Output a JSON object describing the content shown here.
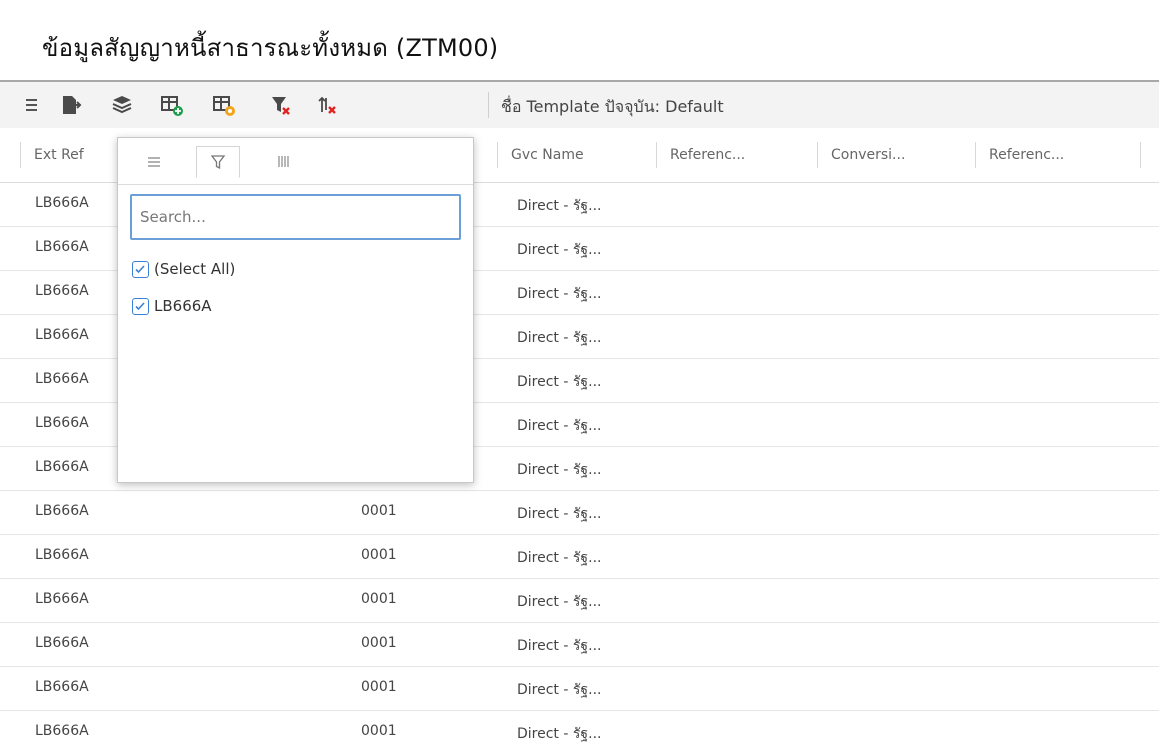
{
  "page": {
    "title": "ข้อมูลสัญญาหนี้สาธารณะทั้งหมด (ZTM00)"
  },
  "toolbar": {
    "template_text": "ชื่อ Template ปัจจุบัน: Default",
    "icons": [
      "menu-icon",
      "export-icon",
      "layers-icon",
      "add-template-icon",
      "edit-template-icon",
      "clear-filter-icon",
      "clear-sort-icon"
    ],
    "colors": {
      "green": "#1e9e4a",
      "orange": "#f2a51a",
      "red": "#e02424",
      "dark": "#4a4a4a"
    }
  },
  "columns": [
    "Ext Ref",
    "Gvc Name",
    "Referenc...",
    "Conversi...",
    "Referenc..."
  ],
  "rows": [
    {
      "ext_ref": "LB666A",
      "code": "",
      "gvc": "Direct - รัฐ..."
    },
    {
      "ext_ref": "LB666A",
      "code": "",
      "gvc": "Direct - รัฐ..."
    },
    {
      "ext_ref": "LB666A",
      "code": "",
      "gvc": "Direct - รัฐ..."
    },
    {
      "ext_ref": "LB666A",
      "code": "",
      "gvc": "Direct - รัฐ..."
    },
    {
      "ext_ref": "LB666A",
      "code": "",
      "gvc": "Direct - รัฐ..."
    },
    {
      "ext_ref": "LB666A",
      "code": "",
      "gvc": "Direct - รัฐ..."
    },
    {
      "ext_ref": "LB666A",
      "code": "",
      "gvc": "Direct - รัฐ..."
    },
    {
      "ext_ref": "LB666A",
      "code": "0001",
      "gvc": "Direct - รัฐ..."
    },
    {
      "ext_ref": "LB666A",
      "code": "0001",
      "gvc": "Direct - รัฐ..."
    },
    {
      "ext_ref": "LB666A",
      "code": "0001",
      "gvc": "Direct - รัฐ..."
    },
    {
      "ext_ref": "LB666A",
      "code": "0001",
      "gvc": "Direct - รัฐ..."
    },
    {
      "ext_ref": "LB666A",
      "code": "0001",
      "gvc": "Direct - รัฐ..."
    },
    {
      "ext_ref": "LB666A",
      "code": "0001",
      "gvc": "Direct - รัฐ..."
    }
  ],
  "filter_popup": {
    "tabs": [
      "general-tab",
      "filter-tab",
      "columns-tab"
    ],
    "search": {
      "placeholder": "Search...",
      "value": ""
    },
    "options": [
      {
        "label": "(Select All)",
        "checked": true
      },
      {
        "label": "LB666A",
        "checked": true
      }
    ],
    "accent": "#3a82d6"
  }
}
